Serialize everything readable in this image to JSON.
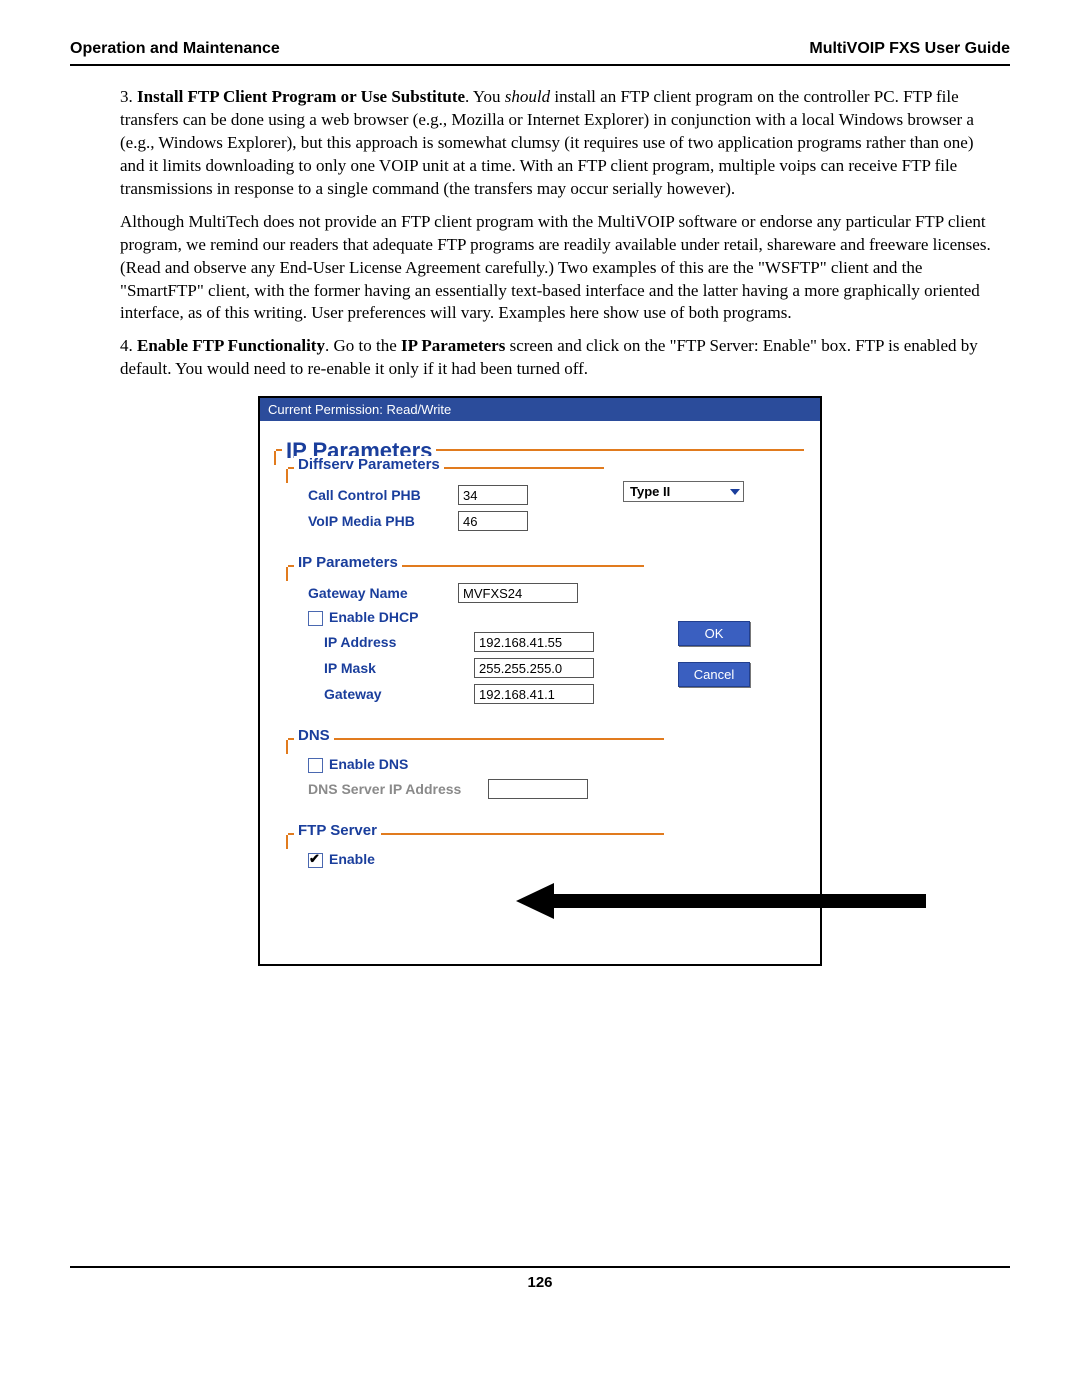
{
  "header": {
    "left": "Operation and Maintenance",
    "right": "MultiVOIP FXS User Guide"
  },
  "step3": {
    "num": "3.",
    "title": "Install FTP Client Program or Use Substitute",
    "lead": ".  You ",
    "lead_em": "should",
    "text": " install an FTP client program on the controller PC.  FTP file transfers can be done using a web browser (e.g., Mozilla or Internet Explorer) in conjunction with a local Windows browser a (e.g., Windows Explorer), but this approach is somewhat clumsy (it requires use of two application programs rather than one) and it limits downloading to only one VOIP unit at a time.  With an FTP client program, multiple voips can receive FTP file transmissions in response to a single command (the transfers may occur serially however)."
  },
  "para2": "Although MultiTech does not provide an FTP client program with the MultiVOIP software or endorse any particular FTP client program, we remind our readers that adequate FTP programs are readily available under retail, shareware and freeware licenses.  (Read and observe any End-User License Agreement carefully.)  Two examples of this are the \"WSFTP\" client and the \"SmartFTP\" client, with the former having an essentially text-based interface and the  latter having a more graphically oriented interface, as of this writing.  User preferences will vary.  Examples here show use of both programs.",
  "step4": {
    "num": "4.",
    "title": "Enable FTP Functionality",
    "text1": ".  Go to the ",
    "bold1": "IP Parameters",
    "text2": " screen and click on the \"FTP Server: Enable\" box.  FTP is enabled by default.  You would need to re-enable it only if it had been turned off."
  },
  "ui": {
    "titlebar": "Current Permission: Read/Write",
    "outer_legend": "IP Parameters",
    "dropdown_value": "Type II",
    "diffserv": {
      "legend": "Diffserv Parameters",
      "call_control_label": "Call Control PHB",
      "call_control_value": "34",
      "voip_media_label": "VoIP Media PHB",
      "voip_media_value": "46"
    },
    "ip": {
      "legend": "IP Parameters",
      "gateway_name_label": "Gateway Name",
      "gateway_name_value": "MVFXS24",
      "enable_dhcp_label": "Enable DHCP",
      "ip_address_label": "IP Address",
      "ip_address_value": "192.168.41.55",
      "ip_mask_label": "IP Mask",
      "ip_mask_value": "255.255.255.0",
      "gateway_label": "Gateway",
      "gateway_value": "192.168.41.1"
    },
    "dns": {
      "legend": "DNS",
      "enable_dns_label": "Enable DNS",
      "dns_server_label": "DNS Server IP Address"
    },
    "ftp": {
      "legend": "FTP Server",
      "enable_label": "Enable"
    },
    "buttons": {
      "ok": "OK",
      "cancel": "Cancel"
    }
  },
  "page_number": "126"
}
